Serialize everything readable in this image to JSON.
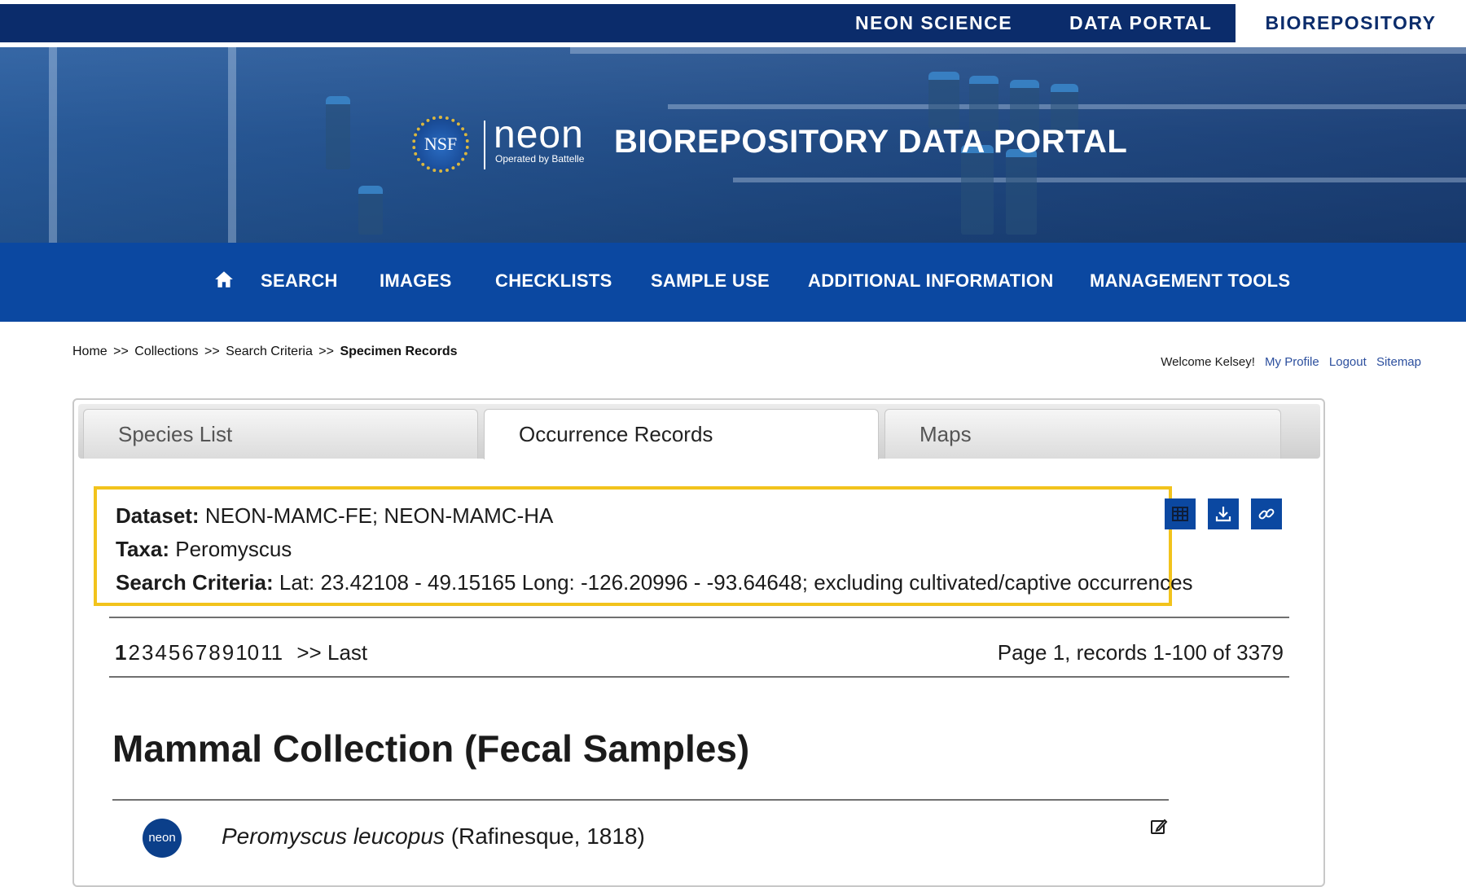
{
  "top_nav": {
    "items": [
      {
        "label": "NEON SCIENCE"
      },
      {
        "label": "DATA PORTAL"
      },
      {
        "label": "BIOREPOSITORY"
      }
    ]
  },
  "banner": {
    "nsf_logo_text": "NSF",
    "neon_logo_text": "neon",
    "neon_logo_subtext": "Operated by Battelle",
    "title": "BIOREPOSITORY DATA PORTAL"
  },
  "main_nav": {
    "home_icon": "home-icon",
    "items": [
      {
        "label": "SEARCH"
      },
      {
        "label": "IMAGES"
      },
      {
        "label": "CHECKLISTS"
      },
      {
        "label": "SAMPLE USE"
      },
      {
        "label": "ADDITIONAL INFORMATION"
      },
      {
        "label": "MANAGEMENT TOOLS"
      }
    ]
  },
  "breadcrumb": {
    "items": [
      "Home",
      "Collections",
      "Search Criteria"
    ],
    "separator": ">>",
    "current": "Specimen Records"
  },
  "user": {
    "welcome": "Welcome Kelsey!",
    "links": [
      "My Profile",
      "Logout",
      "Sitemap"
    ]
  },
  "tabs": [
    {
      "label": "Species List",
      "active": false
    },
    {
      "label": "Occurrence Records",
      "active": true
    },
    {
      "label": "Maps",
      "active": false
    }
  ],
  "criteria": {
    "dataset_label": "Dataset:",
    "dataset_value": "NEON-MAMC-FE; NEON-MAMC-HA",
    "taxa_label": "Taxa:",
    "taxa_value": "Peromyscus",
    "search_label": "Search Criteria:",
    "search_value": "Lat: 23.42108 - 49.15165 Long: -126.20996 - -93.64648; excluding cultivated/captive occurrences",
    "highlight_color": "#f2c31c"
  },
  "actions": {
    "icons": [
      "table-icon",
      "download-icon",
      "link-icon"
    ]
  },
  "pagination": {
    "pages": [
      "1",
      "2",
      "3",
      "4",
      "5",
      "6",
      "7",
      "8",
      "9",
      "10",
      "11"
    ],
    "current": "1",
    "next_label": ">>",
    "last_label": "Last",
    "info": "Page 1, records 1-100 of 3379"
  },
  "collection": {
    "title": "Mammal Collection (Fecal Samples)",
    "logo_text": "neon",
    "record": {
      "scientific_name": "Peromyscus leucopus",
      "author": "(Rafinesque, 1818)",
      "edit_icon": "edit-icon"
    }
  },
  "colors": {
    "top_bar": "#0b2c6b",
    "main_nav": "#0b48a1",
    "link": "#2c4f9e",
    "highlight": "#f2c31c"
  }
}
